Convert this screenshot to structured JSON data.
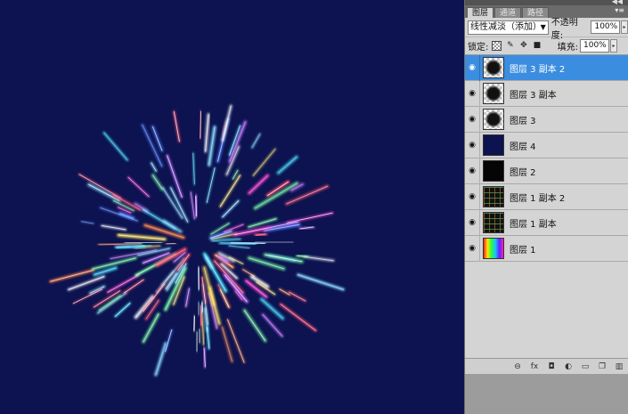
{
  "panel": {
    "tabs": [
      {
        "label": "图层",
        "active": true
      },
      {
        "label": "通道",
        "active": false
      },
      {
        "label": "路径",
        "active": false
      }
    ],
    "blend_mode": "线性减淡（添加）",
    "opacity_label": "不透明度:",
    "opacity_value": "100%",
    "lock_label": "锁定:",
    "fill_label": "填充:",
    "fill_value": "100%",
    "layers": [
      {
        "name": "图层 3 副本 2",
        "selected": true,
        "thumb": "checker"
      },
      {
        "name": "图层 3 副本",
        "selected": false,
        "thumb": "checker"
      },
      {
        "name": "图层 3",
        "selected": false,
        "thumb": "checker"
      },
      {
        "name": "图层 4",
        "selected": false,
        "thumb": "solid-navy"
      },
      {
        "name": "图层 2",
        "selected": false,
        "thumb": "black"
      },
      {
        "name": "图层 1 副本 2",
        "selected": false,
        "thumb": "dark-grid"
      },
      {
        "name": "图层 1 副本",
        "selected": false,
        "thumb": "dark-grid"
      },
      {
        "name": "图层 1",
        "selected": false,
        "thumb": "rainbow"
      }
    ],
    "footer_icons": [
      "link-icon",
      "fx-icon",
      "mask-icon",
      "adjustment-icon",
      "group-icon",
      "new-layer-icon",
      "trash-icon"
    ]
  },
  "canvas": {
    "background": "#0c1350"
  }
}
